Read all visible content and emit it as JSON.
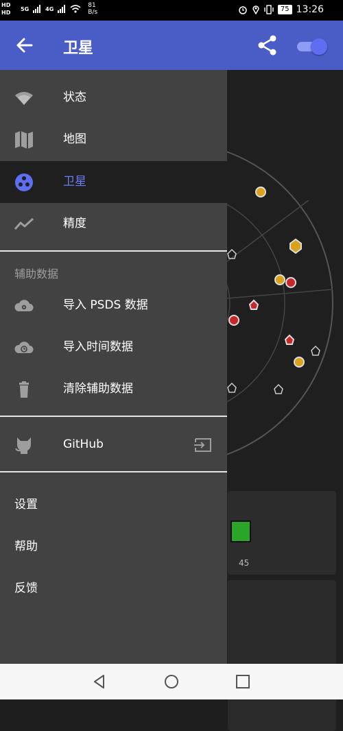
{
  "status_bar": {
    "hd_top": "HD",
    "hd_bottom": "HD",
    "signal_1": "5G",
    "signal_2": "4G",
    "speed_value": "81",
    "speed_unit": "B/s",
    "battery": "75",
    "time": "13:26"
  },
  "app_bar": {
    "title": "卫星",
    "back_icon": "arrow-left-icon",
    "share_icon": "share-icon",
    "toggle_on": true
  },
  "drawer": {
    "items": [
      {
        "label": "状态",
        "icon": "wifi-icon"
      },
      {
        "label": "地图",
        "icon": "map-icon"
      },
      {
        "label": "卫星",
        "icon": "satellite-icon",
        "active": true
      },
      {
        "label": "精度",
        "icon": "trend-icon"
      }
    ],
    "section_title": "辅助数据",
    "assist_items": [
      {
        "label": "导入 PSDS 数据",
        "icon": "cloud-gear-icon"
      },
      {
        "label": "导入时间数据",
        "icon": "cloud-clock-icon"
      },
      {
        "label": "清除辅助数据",
        "icon": "trash-icon"
      }
    ],
    "github": {
      "label": "GitHub",
      "icon": "github-icon",
      "trailing_icon": "exit-icon"
    },
    "footer_items": [
      "设置",
      "帮助",
      "反馈"
    ]
  },
  "background": {
    "tick_label": "45"
  },
  "colors": {
    "app_bar": "#4a5cc6",
    "drawer": "#424242",
    "active_text": "#6c7cf5"
  }
}
